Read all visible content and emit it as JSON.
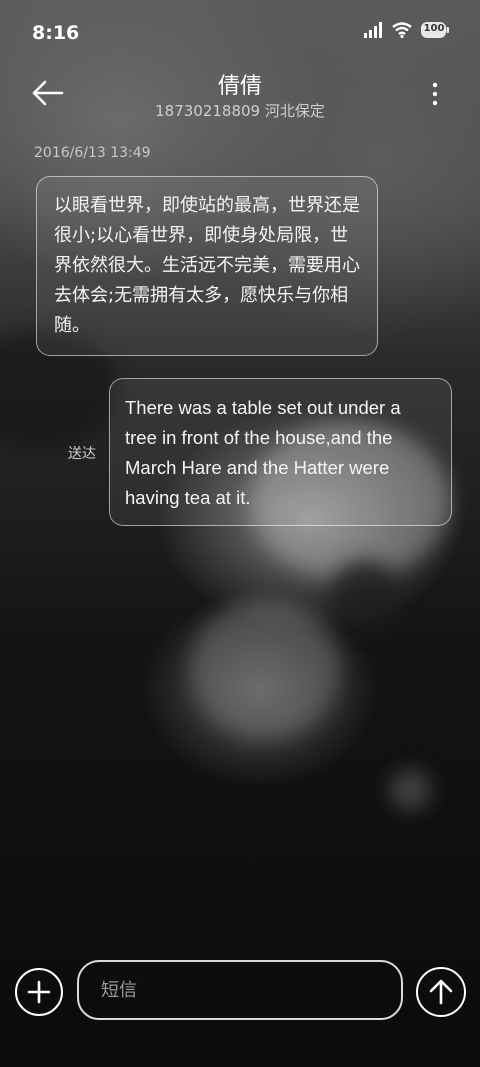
{
  "status_bar": {
    "time": "8:16",
    "battery": "100",
    "icons": [
      "signal-icon",
      "wifi-icon",
      "battery-icon"
    ]
  },
  "header": {
    "contact_name": "倩倩",
    "contact_detail": "18730218809 河北保定",
    "back_icon": "back-arrow-icon",
    "more_icon": "more-vertical-icon"
  },
  "conversation": {
    "timestamp": "2016/6/13 13:49",
    "messages": [
      {
        "direction": "incoming",
        "text": "以眼看世界，即使站的最高，世界还是很小;以心看世界，即使身处局限，世界依然很大。生活远不完美，需要用心去体会;无需拥有太多，愿快乐与你相随。"
      },
      {
        "direction": "outgoing",
        "text": "There was a table set out under a tree in front of the house,and the March Hare and the Hatter were having tea at it.",
        "status": "送达"
      }
    ]
  },
  "composer": {
    "placeholder": "短信",
    "value": "",
    "add_icon": "plus-icon",
    "send_icon": "send-arrow-up-icon"
  },
  "colors": {
    "text": "#ffffff",
    "secondary_text": "#cfcfcf",
    "bubble_border": "#bfbfbf"
  }
}
